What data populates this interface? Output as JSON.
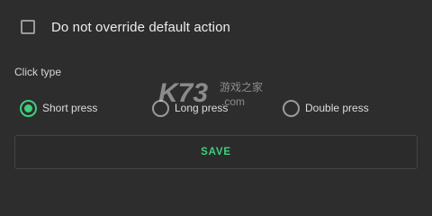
{
  "override_checkbox": {
    "label": "Do not override default action",
    "checked": false
  },
  "click_type": {
    "label": "Click type",
    "options": [
      {
        "label": "Short press",
        "selected": true
      },
      {
        "label": "Long press",
        "selected": false
      },
      {
        "label": "Double press",
        "selected": false
      }
    ]
  },
  "save_button": {
    "label": "SAVE"
  },
  "watermark": {
    "text": "K73 游戏之家 .com"
  },
  "colors": {
    "background": "#2d2d2e",
    "accent": "#3ecf7c",
    "text": "#e8e8e8"
  }
}
